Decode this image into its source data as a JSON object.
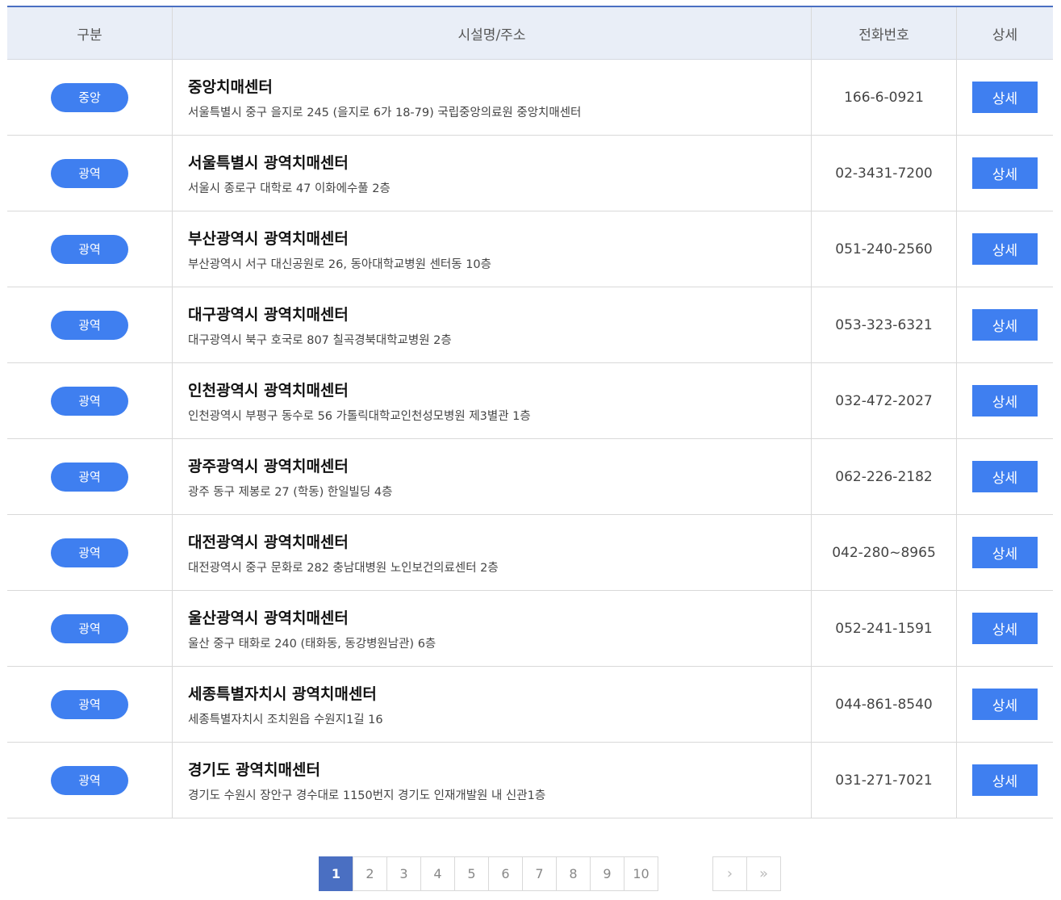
{
  "table": {
    "headers": {
      "category": "구분",
      "name_address": "시설명/주소",
      "phone": "전화번호",
      "detail": "상세"
    },
    "rows": [
      {
        "category": "중앙",
        "name": "중앙치매센터",
        "address": "서울특별시 중구 을지로 245 (을지로 6가 18-79) 국립중앙의료원 중앙치매센터",
        "phone": "166-6-0921",
        "detail_label": "상세"
      },
      {
        "category": "광역",
        "name": "서울특별시 광역치매센터",
        "address": "서울시 종로구 대학로 47 이화에수풀 2층",
        "phone": "02-3431-7200",
        "detail_label": "상세"
      },
      {
        "category": "광역",
        "name": "부산광역시 광역치매센터",
        "address": "부산광역시 서구 대신공원로 26, 동아대학교병원 센터동 10층",
        "phone": "051-240-2560",
        "detail_label": "상세"
      },
      {
        "category": "광역",
        "name": "대구광역시 광역치매센터",
        "address": "대구광역시 북구 호국로 807 칠곡경북대학교병원 2층",
        "phone": "053-323-6321",
        "detail_label": "상세"
      },
      {
        "category": "광역",
        "name": "인천광역시 광역치매센터",
        "address": "인천광역시 부평구 동수로 56 가톨릭대학교인천성모병원 제3별관 1층",
        "phone": "032-472-2027",
        "detail_label": "상세"
      },
      {
        "category": "광역",
        "name": "광주광역시 광역치매센터",
        "address": "광주 동구 제봉로 27 (학동) 한일빌딩 4층",
        "phone": "062-226-2182",
        "detail_label": "상세"
      },
      {
        "category": "광역",
        "name": "대전광역시 광역치매센터",
        "address": "대전광역시 중구 문화로 282 충남대병원 노인보건의료센터 2층",
        "phone": "042-280~8965",
        "detail_label": "상세"
      },
      {
        "category": "광역",
        "name": "울산광역시 광역치매센터",
        "address": "울산 중구 태화로 240 (태화동, 동강병원남관) 6층",
        "phone": "052-241-1591",
        "detail_label": "상세"
      },
      {
        "category": "광역",
        "name": "세종특별자치시 광역치매센터",
        "address": "세종특별자치시 조치원읍 수원지1길 16",
        "phone": "044-861-8540",
        "detail_label": "상세"
      },
      {
        "category": "광역",
        "name": "경기도 광역치매센터",
        "address": "경기도 수원시 장안구 경수대로 1150번지 경기도 인재개발원 내 신관1층",
        "phone": "031-271-7021",
        "detail_label": "상세"
      }
    ]
  },
  "pagination": {
    "pages": [
      "1",
      "2",
      "3",
      "4",
      "5",
      "6",
      "7",
      "8",
      "9",
      "10"
    ],
    "current": "1",
    "next_symbol": "›",
    "last_symbol": "»"
  },
  "colors": {
    "accent": "#3f7ff0",
    "header_bg": "#e9eef7",
    "active_page": "#4a6fc2"
  }
}
